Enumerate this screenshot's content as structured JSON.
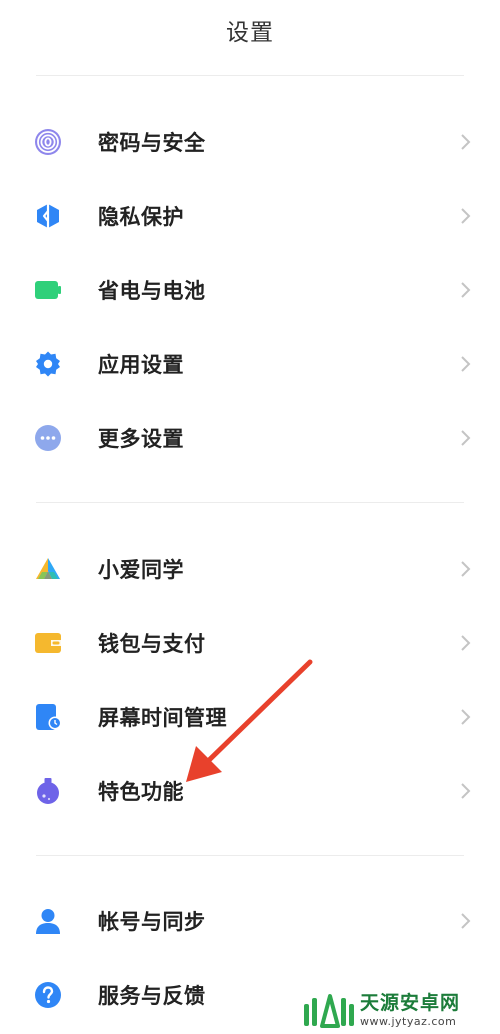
{
  "header": {
    "title": "设置"
  },
  "groups": [
    {
      "items": [
        {
          "label": "密码与安全",
          "icon": "fingerprint-icon"
        },
        {
          "label": "隐私保护",
          "icon": "privacy-shield-icon"
        },
        {
          "label": "省电与电池",
          "icon": "battery-icon"
        },
        {
          "label": "应用设置",
          "icon": "gear-icon"
        },
        {
          "label": "更多设置",
          "icon": "more-dots-icon"
        }
      ]
    },
    {
      "items": [
        {
          "label": "小爱同学",
          "icon": "xiaoai-assistant-icon"
        },
        {
          "label": "钱包与支付",
          "icon": "wallet-icon"
        },
        {
          "label": "屏幕时间管理",
          "icon": "screen-time-icon"
        },
        {
          "label": "特色功能",
          "icon": "special-features-flask-icon"
        }
      ]
    },
    {
      "items": [
        {
          "label": "帐号与同步",
          "icon": "account-person-icon"
        },
        {
          "label": "服务与反馈",
          "icon": "help-question-icon"
        }
      ]
    }
  ],
  "annotation": {
    "color": "#e8412c",
    "target": "特色功能"
  },
  "watermark": {
    "name": "天源安卓网",
    "url": "www.jytyaz.com"
  },
  "colors": {
    "blue": "#2f86f6",
    "green": "#2fd07a",
    "lavender": "#8ea8ec",
    "yellow": "#f5b82e",
    "purple": "#6e63e8",
    "chevron": "#c4c4c4"
  }
}
